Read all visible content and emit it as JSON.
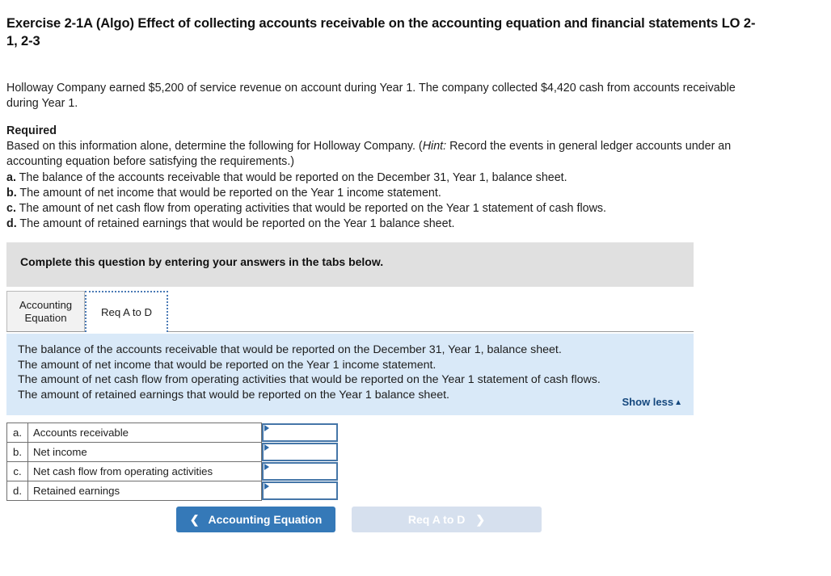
{
  "exercise": {
    "title": "Exercise 2-1A (Algo) Effect of collecting accounts receivable on the accounting equation and financial statements LO 2-1, 2-3",
    "scenario": "Holloway Company earned $5,200 of service revenue on account during Year 1. The company collected $4,420 cash from accounts receivable during Year 1."
  },
  "required": {
    "label": "Required",
    "intro_before_hint": "Based on this information alone, determine the following for Holloway Company. (",
    "hint_word": "Hint:",
    "intro_after_hint": " Record the events in general ledger accounts under an accounting equation before satisfying the requirements.)",
    "items": [
      {
        "letter": "a.",
        "text": " The balance of the accounts receivable that would be reported on the December 31, Year 1, balance sheet."
      },
      {
        "letter": "b.",
        "text": " The amount of net income that would be reported on the Year 1 income statement."
      },
      {
        "letter": "c.",
        "text": " The amount of net cash flow from operating activities that would be reported on the Year 1 statement of cash flows."
      },
      {
        "letter": "d.",
        "text": " The amount of retained earnings that would be reported on the Year 1 balance sheet."
      }
    ]
  },
  "instruction_bar": {
    "text": "Complete this question by entering your answers in the tabs below."
  },
  "tabs": [
    {
      "label": "Accounting Equation",
      "active": false
    },
    {
      "label": "Req A to D",
      "active": true
    }
  ],
  "requirement_panel": {
    "lines": [
      "The balance of the accounts receivable that would be reported on the December 31, Year 1, balance sheet.",
      "The amount of net income that would be reported on the Year 1 income statement.",
      "The amount of net cash flow from operating activities that would be reported on the Year 1 statement of cash flows.",
      "The amount of retained earnings that would be reported on the Year 1 balance sheet."
    ],
    "show_less_label": "Show less",
    "show_less_caret": "▲",
    "background_color": "#d9e9f8"
  },
  "answer_table": {
    "rows": [
      {
        "letter": "a.",
        "label": "Accounts receivable",
        "value": ""
      },
      {
        "letter": "b.",
        "label": "Net income",
        "value": ""
      },
      {
        "letter": "c.",
        "label": "Net cash flow from operating activities",
        "value": ""
      },
      {
        "letter": "d.",
        "label": "Retained earnings",
        "value": ""
      }
    ]
  },
  "nav": {
    "prev_label": "Accounting Equation",
    "prev_chevron": "❮",
    "next_label": "Req A to D",
    "next_chevron": "❯",
    "prev_color": "#3579b8",
    "next_color": "#d6e0ee"
  }
}
